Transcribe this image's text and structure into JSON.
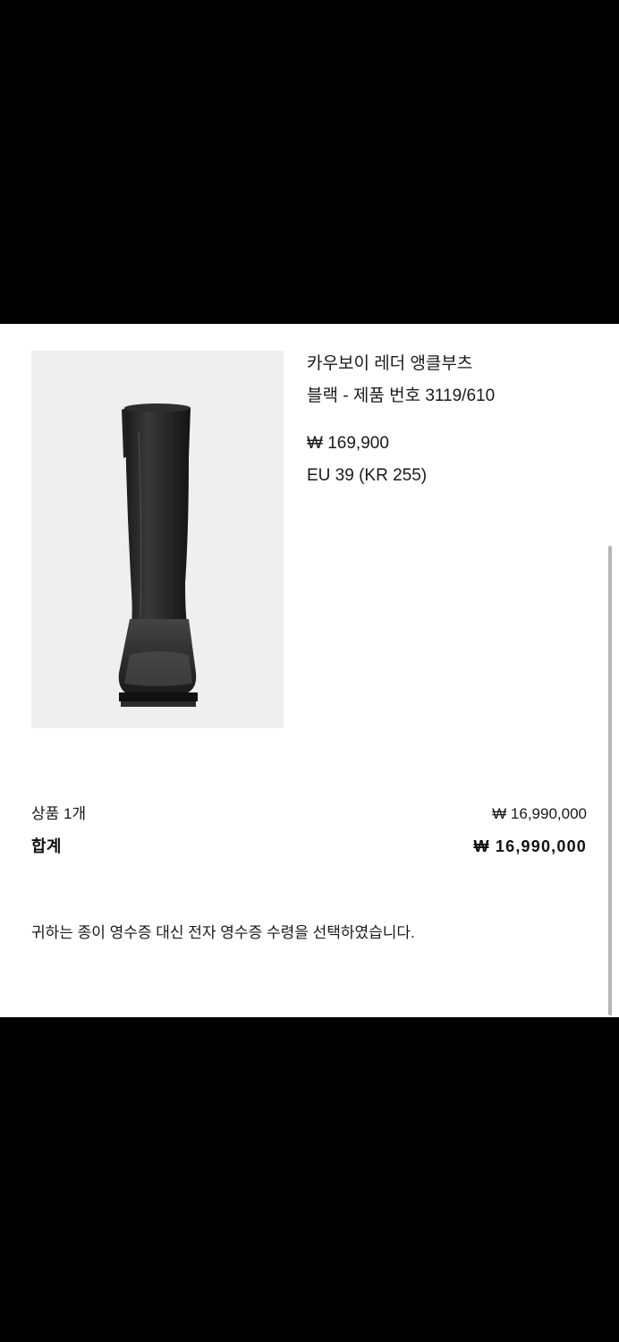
{
  "product": {
    "name": "카우보이 레더 앵클부츠",
    "variant": "블랙 - 제품 번호 3119/610",
    "price": "₩ 169,900",
    "size": "EU 39 (KR 255)",
    "image_icon": "boot-image"
  },
  "summary": {
    "items_label": "상품 1개",
    "items_amount": "₩ 16,990,000",
    "total_label": "합계",
    "total_amount": "₩ 16,990,000"
  },
  "notice": "귀하는 종이 영수증 대신 전자 영수증 수령을 선택하였습니다.",
  "colors": {
    "sheet_bg": "#ffffff",
    "outer_bg": "#000000",
    "image_bg": "#efefef",
    "text": "#1a1a1a"
  }
}
